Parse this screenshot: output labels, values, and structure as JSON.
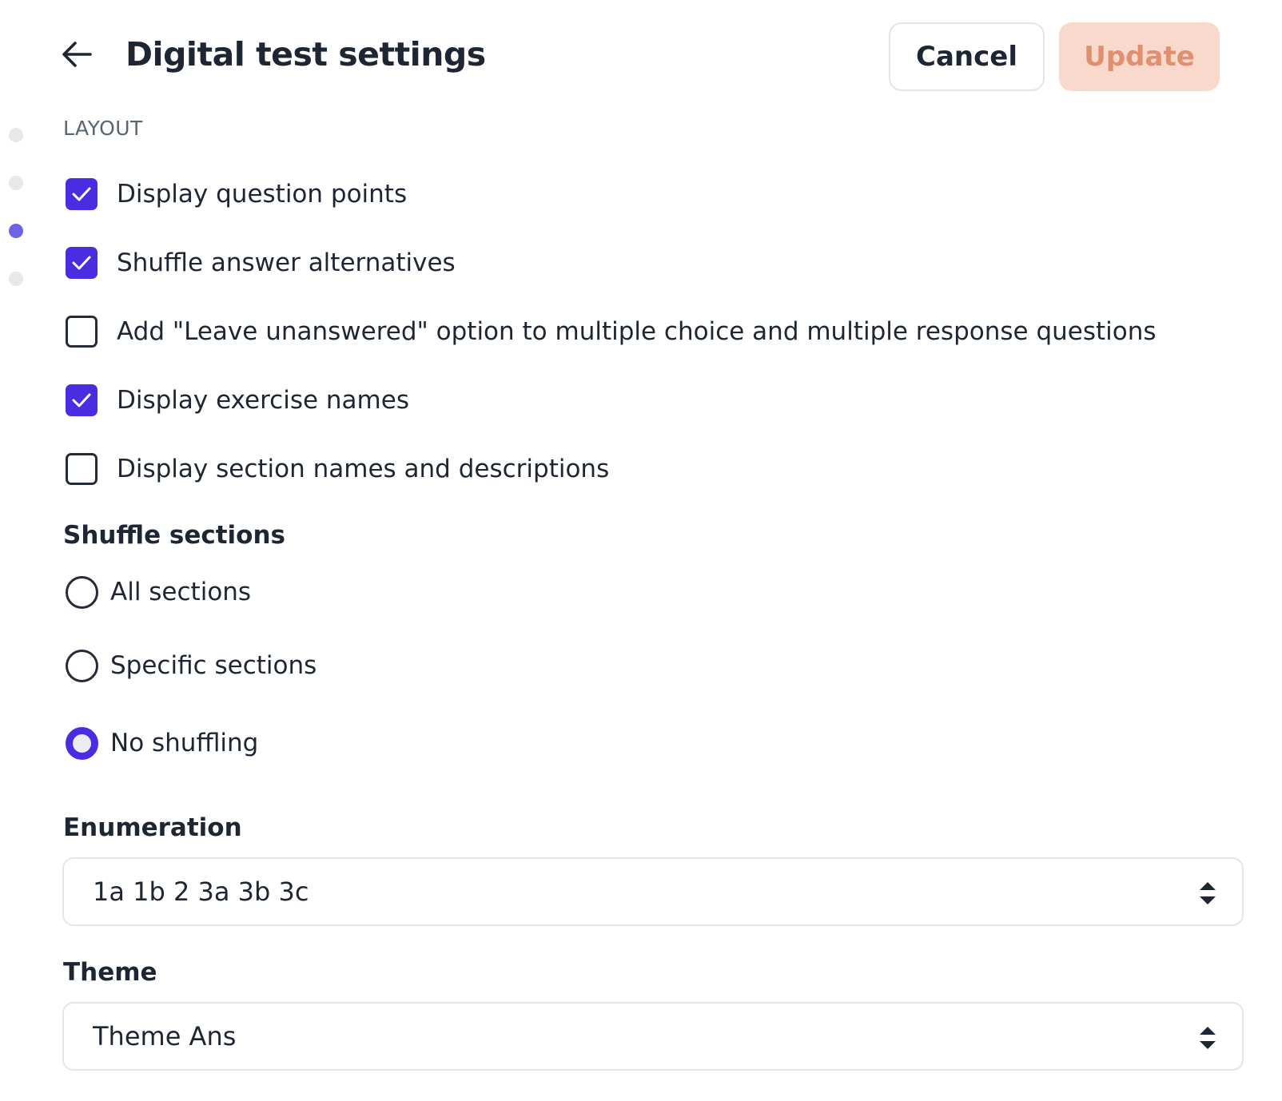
{
  "header": {
    "title": "Digital test settings",
    "cancel_label": "Cancel",
    "update_label": "Update"
  },
  "progress_dots": {
    "count": 4,
    "active_index": 2
  },
  "layout": {
    "section_label": "LAYOUT",
    "options": [
      {
        "label": "Display question points",
        "checked": true
      },
      {
        "label": "Shuffle answer alternatives",
        "checked": true
      },
      {
        "label": "Add \"Leave unanswered\" option to multiple choice and multiple response questions",
        "checked": false
      },
      {
        "label": "Display exercise names",
        "checked": true
      },
      {
        "label": "Display section names and descriptions",
        "checked": false
      }
    ]
  },
  "shuffle_sections": {
    "heading": "Shuffle sections",
    "options": [
      {
        "label": "All sections",
        "selected": false
      },
      {
        "label": "Specific sections",
        "selected": false
      },
      {
        "label": "No shuffling",
        "selected": true
      }
    ]
  },
  "enumeration": {
    "heading": "Enumeration",
    "value": "1a 1b 2 3a 3b 3c"
  },
  "theme": {
    "heading": "Theme",
    "value": "Theme Ans"
  },
  "colors": {
    "accent": "#4a2de0",
    "update_bg": "#f9d9cc",
    "update_text": "#e0906f",
    "dot_active": "#6c63e6",
    "dot_inactive": "#e7e8ea"
  },
  "icons": {
    "back": "arrow-left-icon",
    "check": "checkmark-icon",
    "select": "chevron-up-down-icon"
  }
}
